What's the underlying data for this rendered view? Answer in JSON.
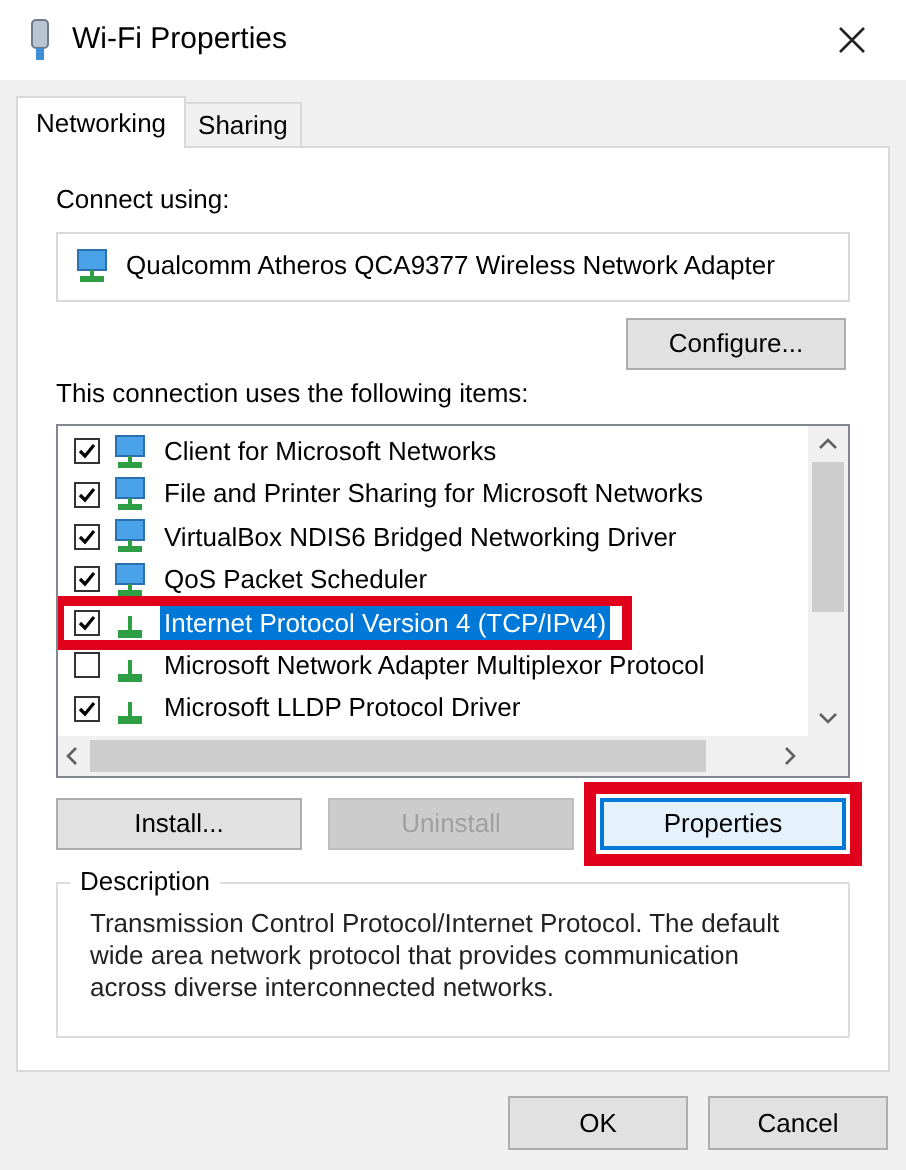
{
  "window": {
    "title": "Wi-Fi Properties"
  },
  "tabs": [
    {
      "label": "Networking",
      "selected": true
    },
    {
      "label": "Sharing",
      "selected": false
    }
  ],
  "connect_using": {
    "label": "Connect using:",
    "adapter": "Qualcomm Atheros QCA9377 Wireless Network Adapter",
    "button": "Configure..."
  },
  "items_label": "This connection uses the following items:",
  "items": [
    {
      "label": "Client for Microsoft Networks",
      "checked": true,
      "selected": false,
      "kind": "client",
      "highlighted": false
    },
    {
      "label": "File and Printer Sharing for Microsoft Networks",
      "checked": true,
      "selected": false,
      "kind": "client",
      "highlighted": false
    },
    {
      "label": "VirtualBox NDIS6 Bridged Networking Driver",
      "checked": true,
      "selected": false,
      "kind": "client",
      "highlighted": false
    },
    {
      "label": "QoS Packet Scheduler",
      "checked": true,
      "selected": false,
      "kind": "client",
      "highlighted": false
    },
    {
      "label": "Internet Protocol Version 4 (TCP/IPv4)",
      "checked": true,
      "selected": true,
      "kind": "protocol",
      "highlighted": true
    },
    {
      "label": "Microsoft Network Adapter Multiplexor Protocol",
      "checked": false,
      "selected": false,
      "kind": "protocol",
      "highlighted": false
    },
    {
      "label": "Microsoft LLDP Protocol Driver",
      "checked": true,
      "selected": false,
      "kind": "protocol",
      "highlighted": false
    }
  ],
  "buttons": [
    {
      "label": "Install...",
      "disabled": false,
      "highlighted": false
    },
    {
      "label": "Uninstall",
      "disabled": true,
      "highlighted": false
    },
    {
      "label": "Properties",
      "disabled": false,
      "highlighted": true
    }
  ],
  "description": {
    "title": "Description",
    "text": "Transmission Control Protocol/Internet Protocol. The default wide area network protocol that provides communication across diverse interconnected networks."
  },
  "footer_buttons": [
    "OK",
    "Cancel"
  ]
}
